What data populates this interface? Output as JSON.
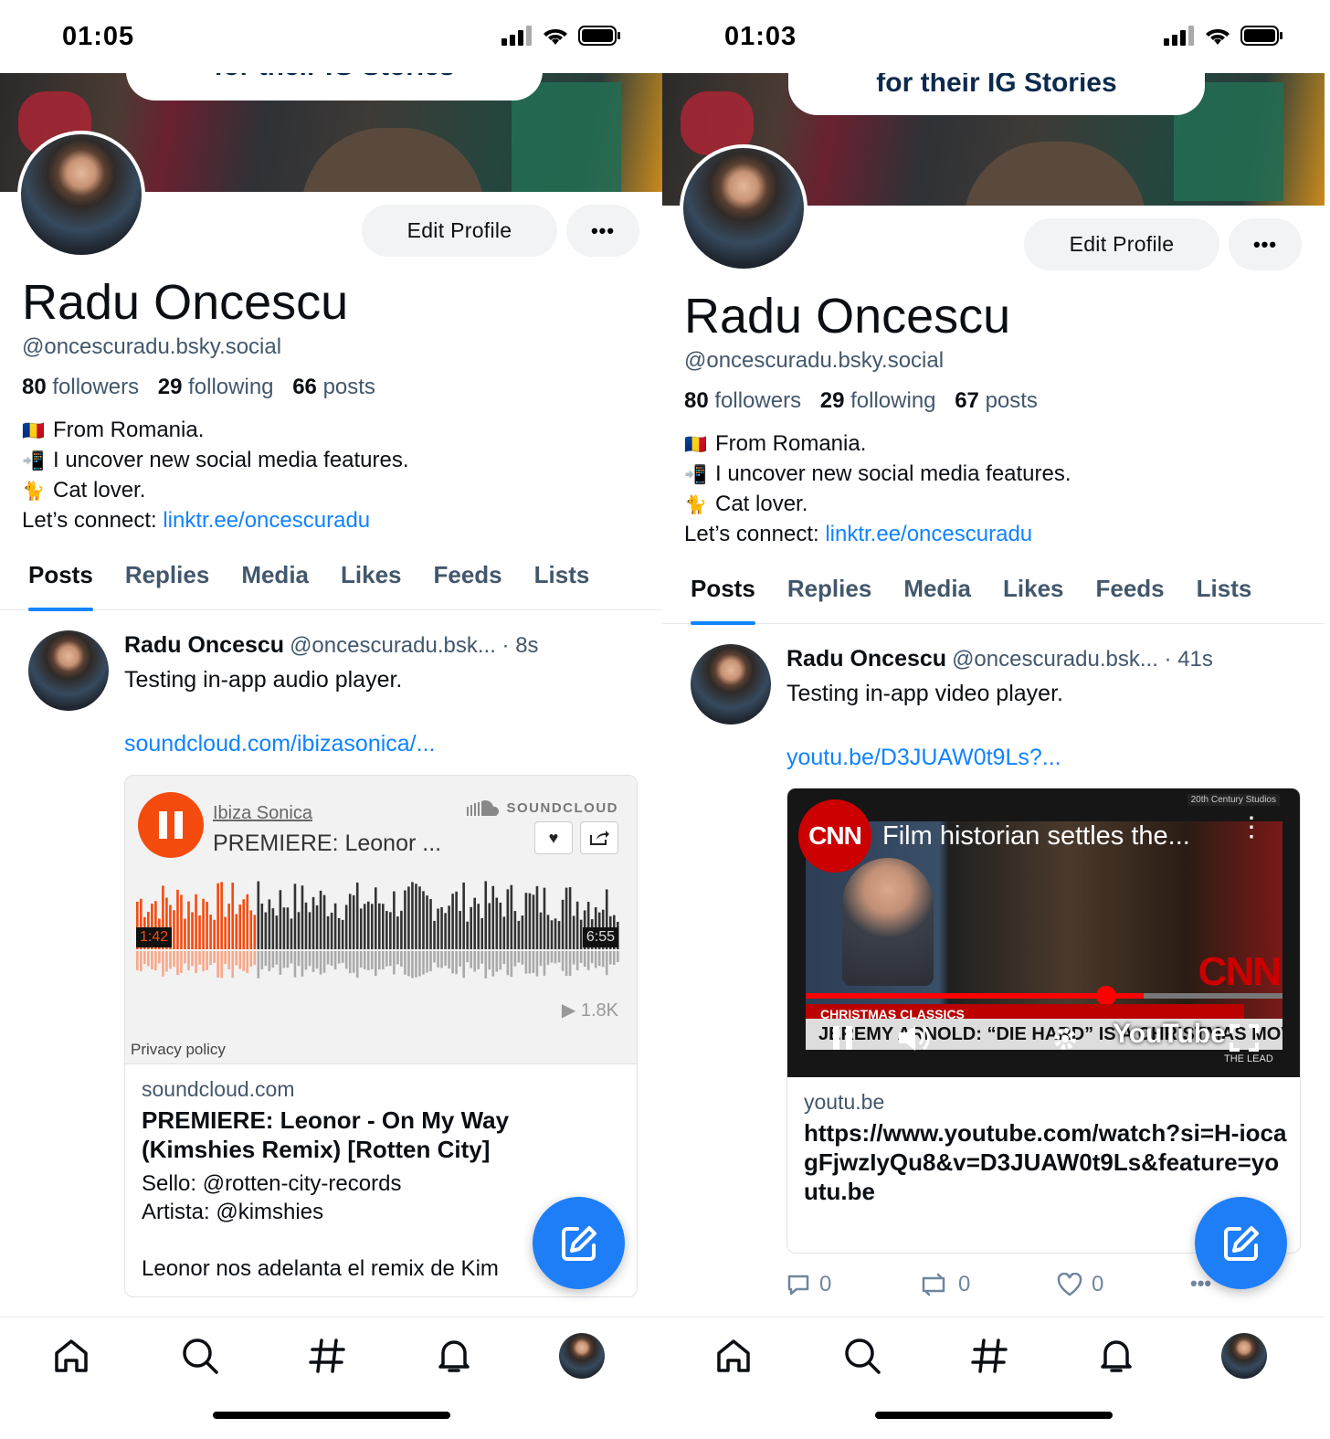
{
  "screens": [
    {
      "status": {
        "time": "01:05"
      },
      "banner_caption": "for their IG Stories",
      "profile": {
        "edit_label": "Edit Profile",
        "more_label": "•••",
        "name": "Radu Oncescu",
        "handle": "@oncescuradu.bsky.social",
        "followers_count": "80",
        "followers_label": "followers",
        "following_count": "29",
        "following_label": "following",
        "posts_count": "66",
        "posts_label": "posts",
        "bio_line1_emoji": "🇷🇴",
        "bio_line1": "From Romania.",
        "bio_line2_emoji": "📲",
        "bio_line2": "I uncover new social media features.",
        "bio_line3_emoji": "🐈",
        "bio_line3": "Cat lover.",
        "bio_connect": "Let’s connect: ",
        "bio_link": "linktr.ee/oncescuradu"
      },
      "tabs": [
        "Posts",
        "Replies",
        "Media",
        "Likes",
        "Feeds",
        "Lists"
      ],
      "active_tab": "Posts",
      "post": {
        "author": "Radu Oncescu",
        "handle": "@oncescuradu.bsk...",
        "time": "· 8s",
        "text": "Testing in-app audio player.",
        "link": "soundcloud.com/ibizasonica/...",
        "embed": {
          "artist": "Ibiza Sonica",
          "track": "PREMIERE: Leonor ...",
          "brand": "SOUNDCLOUD",
          "elapsed": "1:42",
          "duration": "6:55",
          "plays": "1.8K",
          "progress": 0.25,
          "privacy": "Privacy policy",
          "domain": "soundcloud.com",
          "title": "PREMIERE: Leonor - On My Way (Kimshies Remix) [Rotten City]",
          "description": "Sello: @rotten-city-records\nArtista: @kimshies\n\nLeonor nos adelanta el remix de Kim"
        }
      }
    },
    {
      "status": {
        "time": "01:03"
      },
      "banner_caption": "for their IG Stories",
      "profile": {
        "edit_label": "Edit Profile",
        "more_label": "•••",
        "name": "Radu Oncescu",
        "handle": "@oncescuradu.bsky.social",
        "followers_count": "80",
        "followers_label": "followers",
        "following_count": "29",
        "following_label": "following",
        "posts_count": "67",
        "posts_label": "posts",
        "bio_line1_emoji": "🇷🇴",
        "bio_line1": "From Romania.",
        "bio_line2_emoji": "📲",
        "bio_line2": "I uncover new social media features.",
        "bio_line3_emoji": "🐈",
        "bio_line3": "Cat lover.",
        "bio_connect": "Let’s connect: ",
        "bio_link": "linktr.ee/oncescuradu"
      },
      "tabs": [
        "Posts",
        "Replies",
        "Media",
        "Likes",
        "Feeds",
        "Lists"
      ],
      "active_tab": "Posts",
      "post": {
        "author": "Radu Oncescu",
        "handle": "@oncescuradu.bsk...",
        "time": "· 41s",
        "text": "Testing in-app video player.",
        "link": "youtu.be/D3JUAW0t9Ls?...",
        "embed": {
          "channel_logo": "CNN",
          "video_title": "Film historian settles the...",
          "studio_tag": "20th Century Studios",
          "chyron_top": "CHRISTMAS CLASSICS",
          "chyron_main": "JEREMY ARNOLD: “DIE HARD” IS A CHRISTMAS MOVIE",
          "player_brand": "YouTube",
          "network_tag": "THE LEAD",
          "progress": 0.62,
          "domain": "youtu.be",
          "title": "https://www.youtube.com/watch?si=H-iocagFjwzIyQu8&v=D3JUAW0t9Ls&feature=youtu.be"
        },
        "actions": {
          "replies": "0",
          "reposts": "0",
          "likes": "0"
        }
      }
    }
  ],
  "colors": {
    "accent": "#1083fe",
    "soundcloud": "#f54b0f",
    "fab": "#1e7ef7"
  }
}
